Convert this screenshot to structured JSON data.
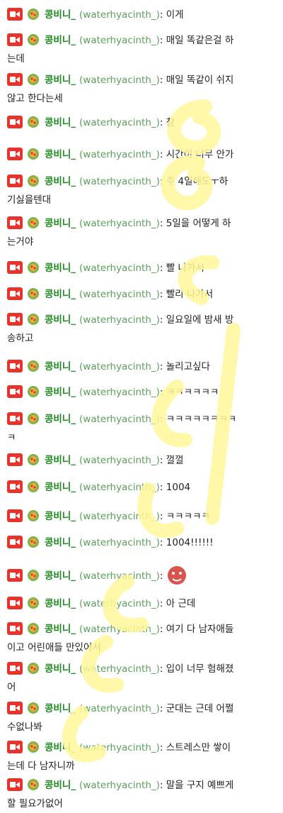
{
  "chat": {
    "user": {
      "nickname": "콩비니_",
      "login": "(waterhyacinth_)",
      "colon": ":",
      "badge_icon": "video-camera-badge",
      "emoji_icon": "rice-ball-emoji"
    },
    "messages": [
      {
        "text": "이게"
      },
      {
        "text": "매일 똑같은걸 하"
      },
      {
        "text": "는데"
      },
      {
        "text": "매일 똑같이 쉬지"
      },
      {
        "text": "않고 한다는세"
      },
      {
        "text": "참"
      },
      {
        "text": "시간이 너무 안가"
      },
      {
        "text": "주 4일해도ㅜ하"
      },
      {
        "text": "기싫을텐대"
      },
      {
        "text": "5일을 어떻게 하"
      },
      {
        "text": "는거야"
      },
      {
        "text": "빨 나가서"
      },
      {
        "text": "빨리 나가서"
      },
      {
        "text": "일요일에 밤새 방"
      },
      {
        "text": "송하고"
      },
      {
        "text": "놀리고싶다"
      },
      {
        "text": "ㅋㅋㅋㅋㅋㅋ"
      },
      {
        "text": "ㅋㅋㅋㅋㅋㅋㅋㅋ"
      },
      {
        "text": "ㅋ"
      },
      {
        "text": "껄껄"
      },
      {
        "text": "1004"
      },
      {
        "text": "ㅋㅋㅋㅋㅋ"
      },
      {
        "text": "1004!!!!!!"
      },
      {
        "text": ""
      },
      {
        "text": "아 근데"
      },
      {
        "text": "여기 다 남자애들"
      },
      {
        "text": "이고 어린애들 만있어서"
      },
      {
        "text": "입이 너무 험해졌"
      },
      {
        "text": "어"
      },
      {
        "text": "군대는 근데 어쩔"
      },
      {
        "text": "수없나봐"
      },
      {
        "text": "스트레스만 쌓이"
      },
      {
        "text": "는데 다 남자니까"
      },
      {
        "text": "말을 구지 예쁘게"
      },
      {
        "text": "할 필요가없어"
      }
    ],
    "emote_icon": "red-face-emote",
    "watermark_color": "#fff799"
  }
}
